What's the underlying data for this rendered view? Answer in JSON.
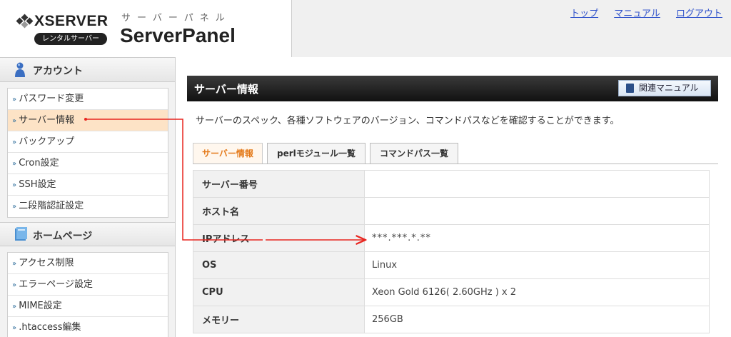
{
  "header": {
    "brand_name": "XSERVER",
    "brand_sub": "レンタルサーバー",
    "panel_kana": "サーバーパネル",
    "panel_name": "ServerPanel",
    "links": [
      "トップ",
      "マニュアル",
      "ログアウト"
    ]
  },
  "sidebar": {
    "sections": [
      {
        "title": "アカウント",
        "icon": "user-icon",
        "items": [
          "パスワード変更",
          "サーバー情報",
          "バックアップ",
          "Cron設定",
          "SSH設定",
          "二段階認証設定"
        ]
      },
      {
        "title": "ホームページ",
        "icon": "book-icon",
        "items": [
          "アクセス制限",
          "エラーページ設定",
          "MIME設定",
          ".htaccess編集"
        ]
      }
    ],
    "active_item": "サーバー情報"
  },
  "main": {
    "title": "サーバー情報",
    "manual_button": "関連マニュアル",
    "description": "サーバーのスペック、各種ソフトウェアのバージョン、コマンドパスなどを確認することができます。",
    "tabs": [
      "サーバー情報",
      "perlモジュール一覧",
      "コマンドパス一覧"
    ],
    "active_tab": "サーバー情報",
    "table": [
      {
        "label": "サーバー番号",
        "value": ""
      },
      {
        "label": "ホスト名",
        "value": ""
      },
      {
        "label": "IPアドレス",
        "value": "***.***.*.**"
      },
      {
        "label": "OS",
        "value": "Linux"
      },
      {
        "label": "CPU",
        "value": "Xeon Gold 6126( 2.60GHz ) x 2"
      },
      {
        "label": "メモリー",
        "value": "256GB"
      }
    ]
  },
  "colors": {
    "accent_tab": "#e47a1a",
    "active_menu_bg": "#fde3c6",
    "link": "#3355cc",
    "annotation": "#e8251f"
  }
}
